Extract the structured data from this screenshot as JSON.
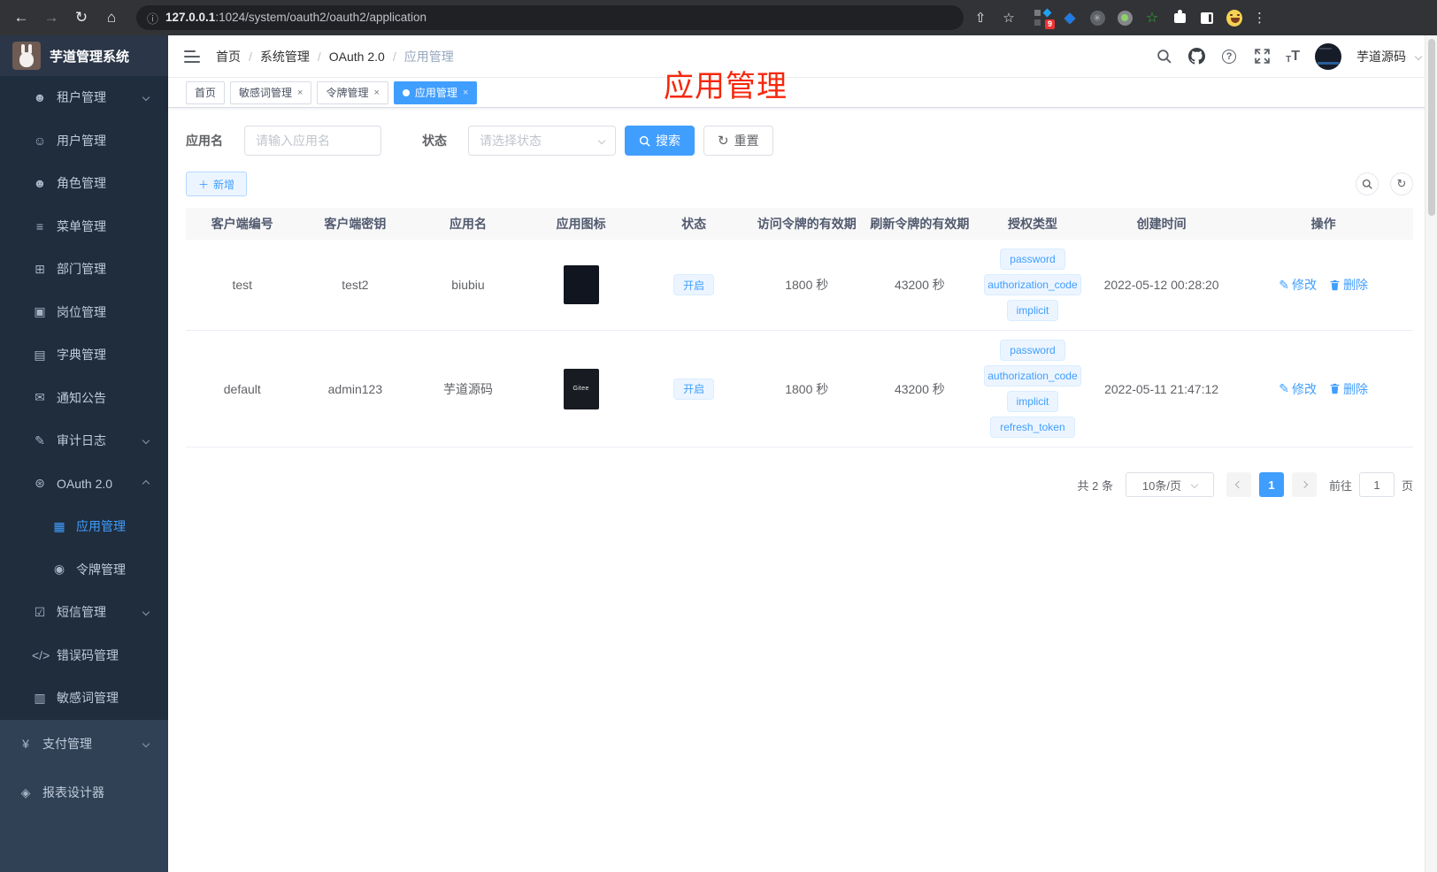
{
  "browser": {
    "url_host": "127.0.0.1",
    "url_rest": ":1024/system/oauth2/oauth2/application",
    "ext_badge": "9"
  },
  "sidebar": {
    "app_title": "芋道管理系统",
    "items": [
      {
        "id": "tenant",
        "icon": "users-icon",
        "glyph": "☻",
        "label": "租户管理",
        "level": 2,
        "section": "sub",
        "arrow": "down",
        "active": false
      },
      {
        "id": "user",
        "icon": "user-icon",
        "glyph": "☺",
        "label": "用户管理",
        "level": 2,
        "section": "sub",
        "arrow": null,
        "active": false
      },
      {
        "id": "role",
        "icon": "roles-icon",
        "glyph": "☻",
        "label": "角色管理",
        "level": 2,
        "section": "sub",
        "arrow": null,
        "active": false
      },
      {
        "id": "menu",
        "icon": "tree-menu-icon",
        "glyph": "≡",
        "label": "菜单管理",
        "level": 2,
        "section": "sub",
        "arrow": null,
        "active": false
      },
      {
        "id": "dept",
        "icon": "org-chart-icon",
        "glyph": "⊞",
        "label": "部门管理",
        "level": 2,
        "section": "sub",
        "arrow": null,
        "active": false
      },
      {
        "id": "post",
        "icon": "badge-icon",
        "glyph": "▣",
        "label": "岗位管理",
        "level": 2,
        "section": "sub",
        "arrow": null,
        "active": false
      },
      {
        "id": "dict",
        "icon": "dictionary-icon",
        "glyph": "▤",
        "label": "字典管理",
        "level": 2,
        "section": "sub",
        "arrow": null,
        "active": false
      },
      {
        "id": "notice",
        "icon": "message-icon",
        "glyph": "✉",
        "label": "通知公告",
        "level": 2,
        "section": "sub",
        "arrow": null,
        "active": false
      },
      {
        "id": "audit",
        "icon": "log-pen-icon",
        "glyph": "✎",
        "label": "审计日志",
        "level": 2,
        "section": "sub",
        "arrow": "down",
        "active": false
      },
      {
        "id": "oauth",
        "icon": "robot-icon",
        "glyph": "⊛",
        "label": "OAuth 2.0",
        "level": 2,
        "section": "sub",
        "arrow": "up",
        "active": false
      },
      {
        "id": "oauth-application",
        "icon": "briefcase-icon",
        "glyph": "▦",
        "label": "应用管理",
        "level": 3,
        "section": "sub",
        "arrow": null,
        "active": true
      },
      {
        "id": "oauth-token",
        "icon": "broadcast-icon",
        "glyph": "◉",
        "label": "令牌管理",
        "level": 3,
        "section": "sub",
        "arrow": null,
        "active": false
      },
      {
        "id": "sms",
        "icon": "shield-check-icon",
        "glyph": "☑",
        "label": "短信管理",
        "level": 2,
        "section": "sub",
        "arrow": "down",
        "active": false
      },
      {
        "id": "errcode",
        "icon": "code-icon",
        "glyph": "</>",
        "label": "错误码管理",
        "level": 2,
        "section": "sub",
        "arrow": null,
        "active": false
      },
      {
        "id": "sensitive",
        "icon": "open-book-icon",
        "glyph": "▥",
        "label": "敏感词管理",
        "level": 2,
        "section": "sub",
        "arrow": null,
        "active": false
      },
      {
        "id": "pay",
        "icon": "yen-icon",
        "glyph": "¥",
        "label": "支付管理",
        "level": 1,
        "section": "root",
        "arrow": "down",
        "active": false
      },
      {
        "id": "report",
        "icon": "report-designer-icon",
        "glyph": "◈",
        "label": "报表设计器",
        "level": 1,
        "section": "root",
        "arrow": null,
        "active": false
      }
    ]
  },
  "header": {
    "breadcrumb": [
      "首页",
      "系统管理",
      "OAuth 2.0",
      "应用管理"
    ],
    "username": "芋道源码"
  },
  "annotation": {
    "text": "应用管理",
    "color": "#f5270d"
  },
  "tabs": [
    {
      "label": "首页",
      "closable": false,
      "active": false
    },
    {
      "label": "敏感词管理",
      "closable": true,
      "active": false
    },
    {
      "label": "令牌管理",
      "closable": true,
      "active": false
    },
    {
      "label": "应用管理",
      "closable": true,
      "active": true
    }
  ],
  "filters": {
    "app_name_label": "应用名",
    "app_name_placeholder": "请输入应用名",
    "status_label": "状态",
    "status_placeholder": "请选择状态",
    "search_label": "搜索",
    "reset_label": "重置",
    "add_label": "新增"
  },
  "table": {
    "columns": [
      "客户端编号",
      "客户端密钥",
      "应用名",
      "应用图标",
      "状态",
      "访问令牌的有效期",
      "刷新令牌的有效期",
      "授权类型",
      "创建时间",
      "操作"
    ],
    "edit_label": "修改",
    "delete_label": "删除",
    "rows": [
      {
        "client_id": "test",
        "secret": "test2",
        "name": "biubiu",
        "icon": "screenshot",
        "icon_text": "",
        "status": "开启",
        "access_validity": "1800 秒",
        "refresh_validity": "43200 秒",
        "grants": [
          "password",
          "authorization_code",
          "implicit"
        ],
        "created": "2022-05-12 00:28:20"
      },
      {
        "client_id": "default",
        "secret": "admin123",
        "name": "芋道源码",
        "icon": "gitee",
        "icon_text": "Gitee",
        "status": "开启",
        "access_validity": "1800 秒",
        "refresh_validity": "43200 秒",
        "grants": [
          "password",
          "authorization_code",
          "implicit",
          "refresh_token"
        ],
        "created": "2022-05-11 21:47:12"
      }
    ]
  },
  "pagination": {
    "total": "共 2 条",
    "page_size": "10条/页",
    "current": "1",
    "goto_label": "前往",
    "goto_value": "1",
    "page_unit": "页"
  }
}
